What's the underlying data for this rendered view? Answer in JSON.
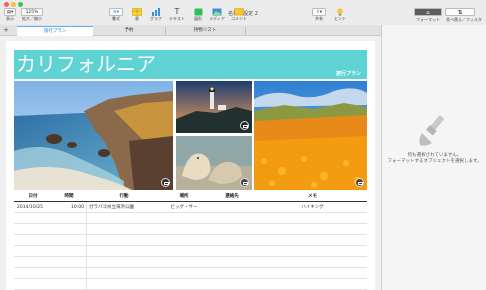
{
  "window": {
    "title": "名称未設定 2"
  },
  "toolbar": {
    "view": {
      "label": "表示"
    },
    "zoom": {
      "value": "125%",
      "label": "拡大／縮小"
    },
    "format_btn": {
      "label": "書式"
    },
    "table_btn": {
      "label": "表"
    },
    "chart_btn": {
      "label": "グラフ"
    },
    "text_btn": {
      "label": "テキスト"
    },
    "shape_btn": {
      "label": "図形"
    },
    "media_btn": {
      "label": "メディア"
    },
    "comment_btn": {
      "label": "コメント"
    },
    "share_btn": {
      "label": "共有"
    },
    "tips_btn": {
      "label": "ヒント"
    },
    "format_panel_btn": {
      "label": "フォーマット"
    },
    "sort_filter_btn": {
      "label": "並べ替え／フィルタ"
    }
  },
  "tabs": [
    {
      "label": "旅行プラン",
      "active": true
    },
    {
      "label": "予約",
      "active": false
    },
    {
      "label": "持物リスト",
      "active": false
    }
  ],
  "sheet": {
    "banner_title": "カリフォルニア",
    "banner_subtitle": "旅行プラン",
    "banner_color": "#5fd2d4"
  },
  "table": {
    "headers": [
      "日付",
      "時間",
      "行動",
      "場所",
      "連絡先",
      "メモ"
    ],
    "rows": [
      [
        "2014/10/25",
        "10:00",
        "ガラパゴ州立海浜公園",
        "ビッグ・サー",
        "",
        "ハイキング"
      ],
      [
        "",
        "",
        "",
        "",
        "",
        ""
      ],
      [
        "",
        "",
        "",
        "",
        "",
        ""
      ],
      [
        "",
        "",
        "",
        "",
        "",
        ""
      ],
      [
        "",
        "",
        "",
        "",
        "",
        ""
      ],
      [
        "",
        "",
        "",
        "",
        "",
        ""
      ],
      [
        "",
        "",
        "",
        "",
        "",
        ""
      ],
      [
        "",
        "",
        "",
        "",
        "",
        ""
      ]
    ]
  },
  "panel": {
    "message_line1": "何も選択されていません。",
    "message_line2": "フォーマットするオブジェクトを選択します。"
  }
}
